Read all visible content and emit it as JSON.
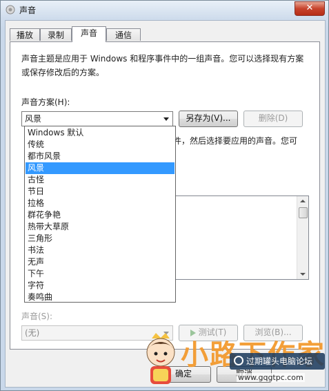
{
  "window": {
    "title": "声音",
    "close_glyph": "✕"
  },
  "tabs": [
    {
      "label": "播放"
    },
    {
      "label": "录制"
    },
    {
      "label": "声音"
    },
    {
      "label": "通信"
    }
  ],
  "sound_page": {
    "description": "声音主题是应用于 Windows 和程序事件中的一组声音。您可以选择现有方案或保存修改后的方案。",
    "scheme_label": "声音方案(H):",
    "scheme_value": "风景",
    "save_as_button": "另存为(V)...",
    "delete_button": "删除(D)",
    "partial_text": "件，然后选择要应用的声音。您可",
    "sound_label": "声音(S):",
    "sound_value": "(无)",
    "test_button": "测试(T)",
    "browse_button": "浏览(B)..."
  },
  "scheme_dropdown": {
    "options": [
      "Windows 默认",
      "传统",
      "都市风景",
      "风景",
      "古怪",
      "节日",
      "拉格",
      "群花争艳",
      "热带大草原",
      "三角形",
      "书法",
      "无声",
      "下午",
      "字符",
      "奏鸣曲"
    ],
    "selected_index": 3
  },
  "dialog_buttons": {
    "ok": "确定",
    "cancel": "取消"
  },
  "watermark": {
    "brand": "小路下作家",
    "forum_badge": "过期罐头电脑论坛",
    "url": "www.gqgtpc.com"
  },
  "colors": {
    "selection": "#3399ff",
    "close_button": "#c7432c",
    "watermark_orange": "#f39a2f"
  }
}
